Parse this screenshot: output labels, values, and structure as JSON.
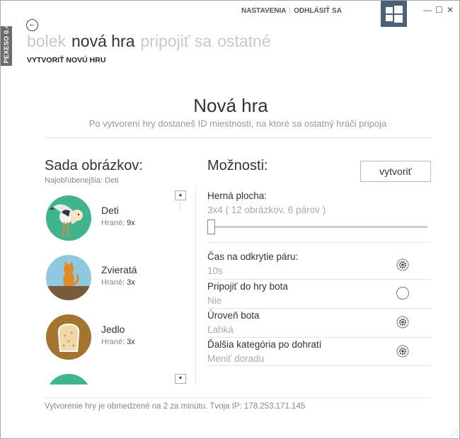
{
  "app": {
    "side_tab": "PEXESO 0.4"
  },
  "topbar": {
    "settings": "NASTAVENIA",
    "logout": "ODHLÁSIŤ SA",
    "separator": "|"
  },
  "window_controls": {
    "minimize": "—",
    "maximize": "☐",
    "close": "✕"
  },
  "nav": {
    "back": "←",
    "tabs": [
      "bolek",
      "nová hra",
      "pripojiť sa",
      "ostatné"
    ],
    "active_tab": "nová hra",
    "subheading": "VYTVORIŤ NOVÚ HRU"
  },
  "header": {
    "title": "Nová hra",
    "subtitle": "Po vytvorení hry dostaneš ID miestnosti, na ktoré sa ostatný hráči pripoja"
  },
  "image_sets": {
    "title": "Sada obrázkov:",
    "popular": "Najobľúbenejšia: Deti",
    "scroll_up": "▲",
    "scroll_down": "▼",
    "items": [
      {
        "name": "Deti",
        "played_label": "Hrané:",
        "played_count": "9x",
        "color": "#3fb48e",
        "icon": "stork-icon"
      },
      {
        "name": "Zvieratá",
        "played_label": "Hrané:",
        "played_count": "3x",
        "color": "#8fc9e0",
        "icon": "cat-icon"
      },
      {
        "name": "Jedlo",
        "played_label": "Hrané:",
        "played_count": "3x",
        "color": "#a3742e",
        "icon": "toast-icon"
      },
      {
        "name": "",
        "played_label": "",
        "played_count": "",
        "color": "#3fb48e",
        "icon": "partial-item-icon"
      }
    ]
  },
  "options": {
    "title": "Možnosti:",
    "create_button": "vytvoriť",
    "board": {
      "label": "Herná plocha:",
      "value": "3x4 ( 12 obrázkov, 6 párov )",
      "slider_fraction": 0.0
    },
    "rows": [
      {
        "label": "Čas na odkrytie páru:",
        "value": "10s",
        "control": "gear-icon"
      },
      {
        "label": "Pripojiť do hry bota",
        "value": "Nie",
        "control": "radio"
      },
      {
        "label": "Úroveň bota",
        "value": "Ľahká",
        "control": "gear-icon"
      },
      {
        "label": "Ďalšia kategória po dohratí",
        "value": "Meniť doradu",
        "control": "gear-icon"
      }
    ]
  },
  "footer": {
    "text": "Vytvorenie hry je obmedzené na 2 za minútu. Tvoja IP: 178.253.171.145"
  }
}
